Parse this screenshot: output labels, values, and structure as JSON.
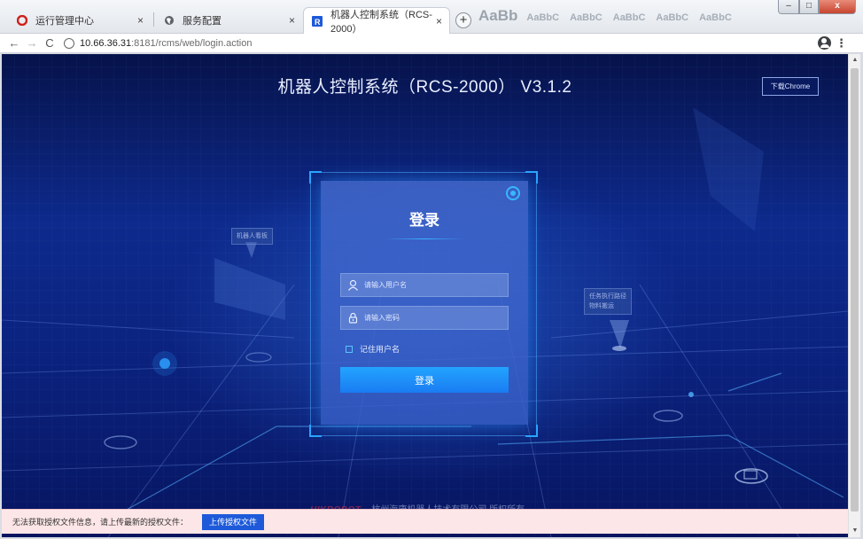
{
  "browser": {
    "tabs": [
      {
        "label": "运行管理中心",
        "active": false,
        "icon": "opera-icon"
      },
      {
        "label": "服务配置",
        "active": false,
        "icon": "globe-icon"
      },
      {
        "label": "机器人控制系统（RCS-2000）",
        "active": true,
        "icon": "r-badge-icon"
      }
    ],
    "close_glyph": "×",
    "new_tab_glyph": "+",
    "styles_strip": {
      "big": "AaBb",
      "items": [
        "AaBbC",
        "AaBbC",
        "AaBbC",
        "AaBbC",
        "AaBbC"
      ]
    },
    "window_buttons": {
      "minimize": "–",
      "maximize": "□",
      "close": "x"
    },
    "nav": {
      "back": "←",
      "forward": "→",
      "reload": "C"
    },
    "url": {
      "host": "10.66.36.31",
      "rest": ":8181/rcms/web/login.action"
    },
    "menu_glyph": "⋮"
  },
  "page": {
    "system_title": "机器人控制系统（RCS-2000） V3.1.2",
    "download_chrome_label": "下载Chrome",
    "scene_labels": [
      {
        "lines": [
          "机器人看板"
        ]
      },
      {
        "lines": [
          "任务执行路径",
          "物料搬运"
        ]
      }
    ],
    "login": {
      "title": "登录",
      "username_placeholder": "请输入用户名",
      "password_placeholder": "请输入密码",
      "remember_label": "记住用户名",
      "submit_label": "登录"
    },
    "footer": {
      "brand": "HIKROBOT",
      "company": "杭州海康机器人技术有限公司   版权所有"
    },
    "license": {
      "message": "无法获取授权文件信息，请上传最新的授权文件：",
      "upload_label": "上传授权文件"
    }
  },
  "colors": {
    "accent": "#1a7cf2",
    "background_deep": "#071560",
    "license_bar": "#fde6e7",
    "upload_button": "#1d59d9"
  }
}
